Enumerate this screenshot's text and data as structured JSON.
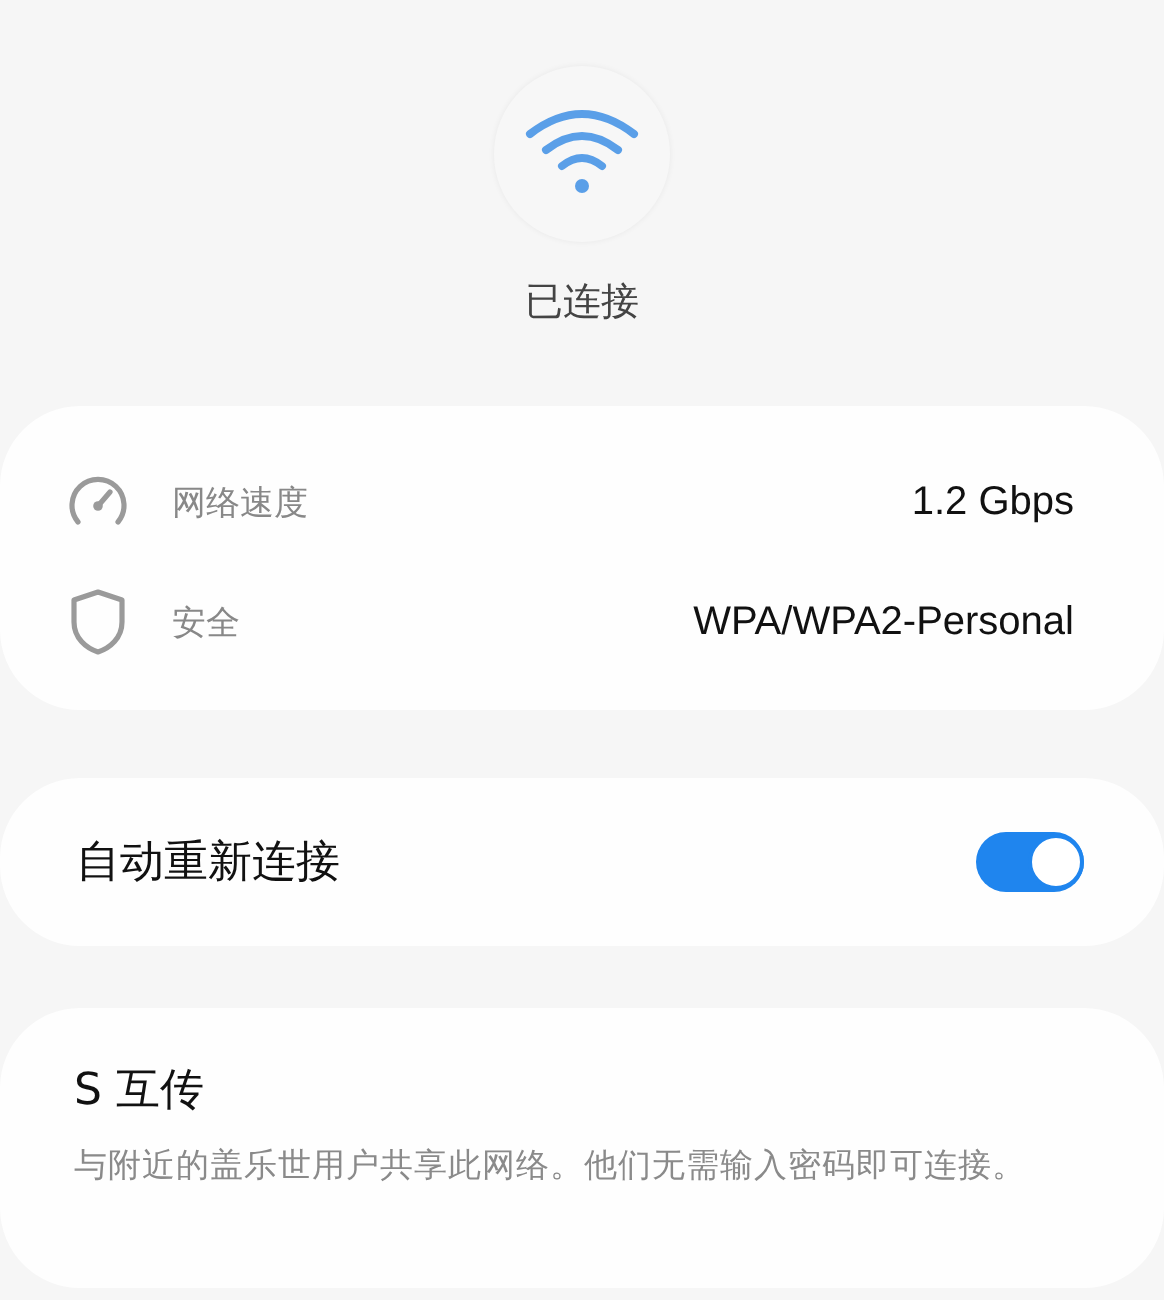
{
  "status": "已连接",
  "details": [
    {
      "kind": "speed",
      "label": "网络速度",
      "value": "1.2 Gbps"
    },
    {
      "kind": "security",
      "label": "安全",
      "value": "WPA/WPA2-Personal"
    }
  ],
  "auto_reconnect": {
    "label": "自动重新连接",
    "on": true
  },
  "share": {
    "title": "S 互传",
    "description": "与附近的盖乐世用户共享此网络。他们无需输入密码即可连接。"
  }
}
